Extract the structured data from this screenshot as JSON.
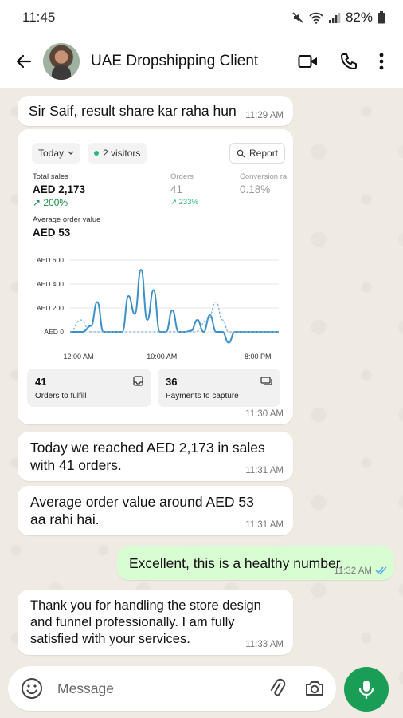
{
  "status_bar": {
    "time": "11:45",
    "battery": "82%"
  },
  "header": {
    "contact_name": "UAE Dropshipping Client"
  },
  "messages": [
    {
      "text": "Sir Saif, result share kar raha hun",
      "time": "11:29 AM",
      "direction": "incoming"
    },
    {
      "time": "11:30 AM",
      "direction": "incoming",
      "type": "screenshot"
    },
    {
      "text": "Today we reached AED 2,173 in sales with 41 orders.",
      "time": "11:31 AM",
      "direction": "incoming"
    },
    {
      "text": "Average order value around AED 53 aa rahi hai.",
      "time": "11:31 AM",
      "direction": "incoming"
    },
    {
      "text": "Excellent, this is a healthy number.",
      "time": "11:32 AM",
      "direction": "outgoing"
    },
    {
      "text": "Thank you for handling the store design and funnel professionally. I am fully satisfied with your services.",
      "time": "11:33 AM",
      "direction": "incoming"
    }
  ],
  "dashboard": {
    "date_filter": "Today",
    "visitors": "2 visitors",
    "report_label": "Report",
    "total_sales_label": "Total sales",
    "total_sales_value": "AED 2,173",
    "total_sales_delta": "↗ 200%",
    "orders_label": "Orders",
    "orders_value": "41",
    "orders_delta": "↗ 233%",
    "conversion_label": "Conversion ra",
    "conversion_value": "0.18%",
    "aov_label": "Average order value",
    "aov_value": "AED 53",
    "tile_orders_num": "41",
    "tile_orders_label": "Orders to fulfill",
    "tile_payments_num": "36",
    "tile_payments_label": "Payments to capture"
  },
  "chart_data": {
    "type": "line",
    "x_tick_labels": [
      "12:00 AM",
      "10:00 AM",
      "8:00 PM"
    ],
    "y_tick_labels": [
      "AED 600",
      "AED 400",
      "AED 200",
      "AED 0"
    ],
    "ylim": [
      0,
      600
    ],
    "series": [
      {
        "x": [
          0,
          0.06,
          0.1,
          0.13,
          0.16,
          0.2,
          0.25,
          0.28,
          0.31,
          0.34,
          0.37,
          0.4,
          0.43,
          0.46,
          0.49,
          0.52,
          0.55,
          0.58,
          0.61,
          0.64,
          0.67,
          0.7,
          0.73,
          0.76,
          0.79,
          0.82,
          0.85,
          0.88,
          0.91,
          0.95,
          1.0
        ],
        "values": [
          0,
          0,
          50,
          250,
          0,
          0,
          0,
          300,
          150,
          520,
          100,
          350,
          0,
          0,
          180,
          0,
          0,
          10,
          100,
          0,
          140,
          0,
          0,
          -90,
          0,
          0,
          0,
          0,
          0,
          0,
          0
        ]
      },
      {
        "dashed": true,
        "x": [
          0,
          0.05,
          0.1,
          0.15,
          0.2,
          0.3,
          0.4,
          0.5,
          0.6,
          0.66,
          0.7,
          0.73,
          0.76,
          0.8,
          0.85,
          1.0
        ],
        "values": [
          0,
          100,
          0,
          0,
          0,
          0,
          0,
          0,
          0,
          100,
          250,
          100,
          0,
          0,
          0,
          0
        ]
      }
    ]
  }
}
